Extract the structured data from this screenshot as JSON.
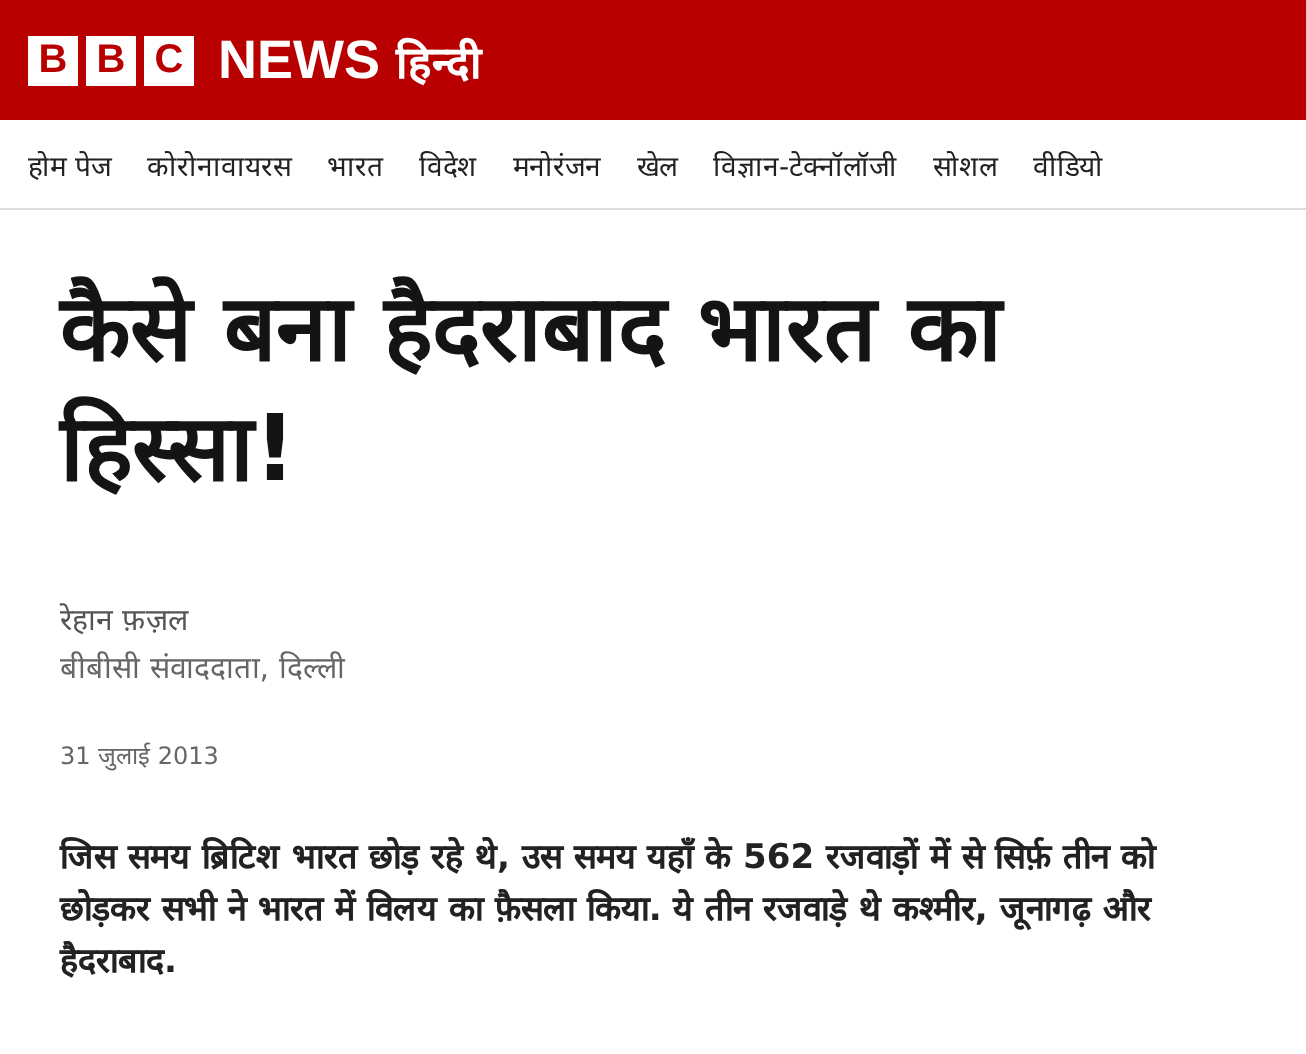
{
  "header": {
    "logo_letters": [
      "B",
      "B",
      "C"
    ],
    "brand": "NEWS",
    "edition": "हिन्दी"
  },
  "nav": [
    {
      "label": "होम पेज"
    },
    {
      "label": "कोरोनावायरस"
    },
    {
      "label": "भारत"
    },
    {
      "label": "विदेश"
    },
    {
      "label": "मनोरंजन"
    },
    {
      "label": "खेल"
    },
    {
      "label": "विज्ञान-टेक्नॉलॉजी"
    },
    {
      "label": "सोशल"
    },
    {
      "label": "वीडियो"
    }
  ],
  "article": {
    "headline": "कैसे बना हैदराबाद भारत का हिस्सा!",
    "author": "रेहान फ़ज़ल",
    "author_role": "बीबीसी संवाददाता, दिल्ली",
    "date": "31 जुलाई 2013",
    "lead": "जिस समय ब्रिटिश भारत छोड़ रहे थे, उस समय यहाँ के 562 रजवाड़ों में से सिर्फ़ तीन को छोड़कर सभी ने भारत में विलय का फ़ैसला किया. ये तीन रजवाड़े थे कश्मीर, जूनागढ़ और हैदराबाद."
  }
}
